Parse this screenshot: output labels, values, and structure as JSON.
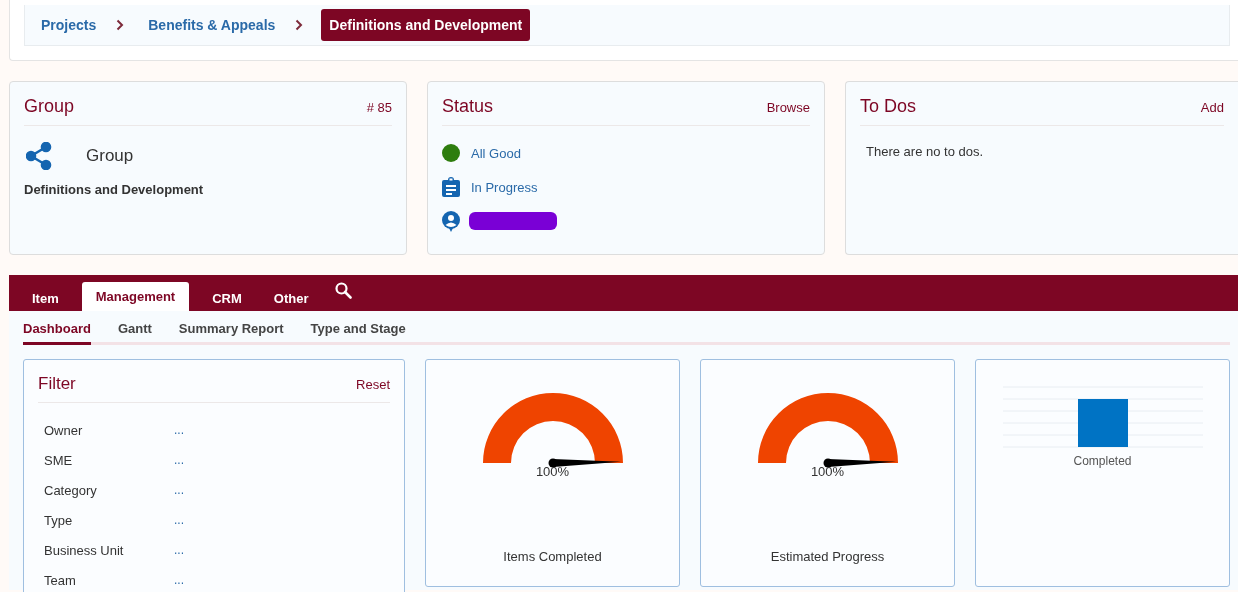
{
  "breadcrumb": [
    {
      "label": "Projects",
      "selected": false
    },
    {
      "label": "Benefits & Appeals",
      "selected": false
    },
    {
      "label": "Definitions and Development",
      "selected": true
    }
  ],
  "group_card": {
    "title": "Group",
    "number": "# 85",
    "type_label": "Group",
    "name": "Definitions and Development"
  },
  "status_card": {
    "title": "Status",
    "action": "Browse",
    "items": [
      {
        "kind": "dot",
        "color": "#2e7d0e",
        "label": "All Good"
      },
      {
        "kind": "clipboard",
        "label": "In Progress"
      },
      {
        "kind": "person-redacted"
      }
    ]
  },
  "todos_card": {
    "title": "To Dos",
    "action": "Add",
    "message": "There are no to dos."
  },
  "tabs": [
    {
      "label": "Item",
      "selected": false
    },
    {
      "label": "Management",
      "selected": true
    },
    {
      "label": "CRM",
      "selected": false
    },
    {
      "label": "Other",
      "selected": false
    }
  ],
  "subtabs": [
    {
      "label": "Dashboard",
      "selected": true
    },
    {
      "label": "Gantt",
      "selected": false
    },
    {
      "label": "Summary Report",
      "selected": false
    },
    {
      "label": "Type and Stage",
      "selected": false
    }
  ],
  "filter": {
    "title": "Filter",
    "action": "Reset",
    "rows": [
      {
        "label": "Owner",
        "value": "..."
      },
      {
        "label": "SME",
        "value": "..."
      },
      {
        "label": "Category",
        "value": "..."
      },
      {
        "label": "Type",
        "value": "..."
      },
      {
        "label": "Business Unit",
        "value": "..."
      },
      {
        "label": "Team",
        "value": "..."
      }
    ]
  },
  "gauges": [
    {
      "value": "100%",
      "label": "Items Completed"
    },
    {
      "value": "100%",
      "label": "Estimated Progress"
    }
  ],
  "bar_panel": {
    "label": "Completed"
  }
}
